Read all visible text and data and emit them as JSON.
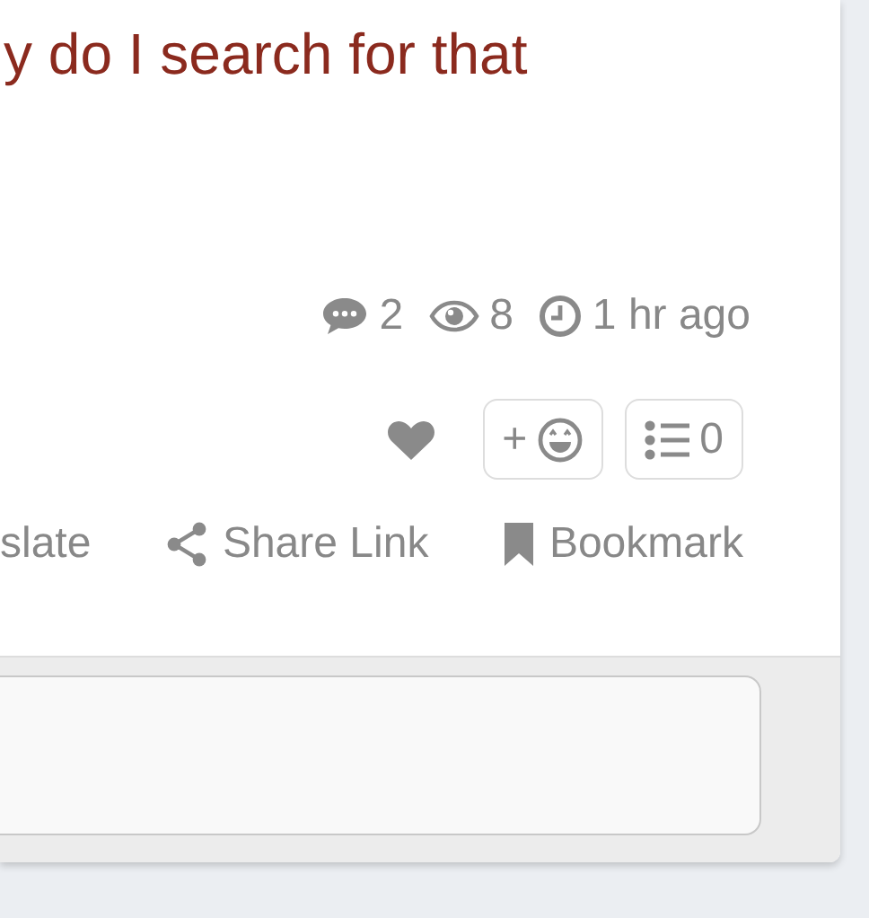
{
  "post": {
    "title": "y do I search for that"
  },
  "stats": [
    {
      "kind": "comments",
      "text": "2"
    },
    {
      "kind": "views",
      "text": "8"
    },
    {
      "kind": "time",
      "text": "1 hr ago"
    }
  ],
  "reactions": {
    "add_label": "+",
    "list_count": "0"
  },
  "actions": [
    {
      "kind": "translate",
      "label": "slate"
    },
    {
      "kind": "share",
      "label": "Share Link"
    },
    {
      "kind": "bookmark",
      "label": "Bookmark"
    }
  ]
}
